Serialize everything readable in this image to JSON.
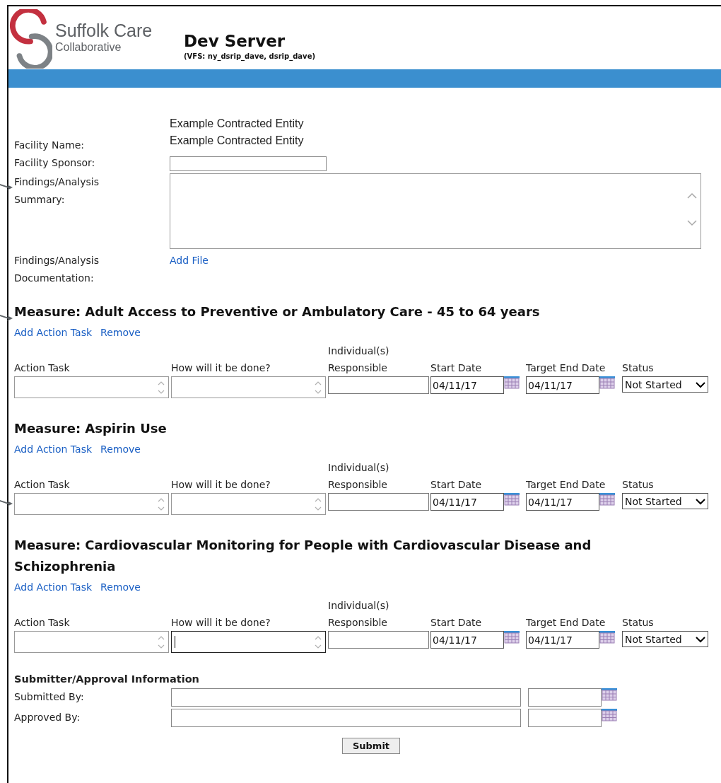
{
  "header": {
    "logo_name": "Suffolk Care",
    "logo_sub": "Collaborative",
    "title": "Dev Server",
    "subtitle": "(VFS: ny_dsrip_dave, dsrip_dave)"
  },
  "entity_heading": "Example Contracted Entity",
  "fields": [
    {
      "label": "Facility Name:",
      "kind": "text",
      "value": "Example Contracted Entity"
    },
    {
      "label": "Facility Sponsor:",
      "kind": "input"
    },
    {
      "label": "Findings/Analysis Summary:",
      "kind": "textarea"
    },
    {
      "label": "Findings/Analysis Documentation:",
      "kind": "link",
      "value": "Add File"
    }
  ],
  "measures": [
    {
      "title": "Measure: Adult Access to Preventive or Ambulatory Care - 45 to 64 years",
      "links": [
        "Add Action Task",
        "Remove"
      ],
      "columns": [
        "Action Task",
        "How will it be done?",
        "Individual(s) Responsible",
        "Start Date",
        "Target End Date",
        "Status"
      ],
      "rows": [
        {
          "how_focused": false,
          "start_date": "04/11/17",
          "end_date": "04/11/17",
          "status": "Not Started"
        }
      ]
    },
    {
      "title": "Measure: Aspirin Use",
      "links": [
        "Add Action Task",
        "Remove"
      ],
      "columns": [
        "Action Task",
        "How will it be done?",
        "Individual(s) Responsible",
        "Start Date",
        "Target End Date",
        "Status"
      ],
      "rows": [
        {
          "how_focused": false,
          "start_date": "04/11/17",
          "end_date": "04/11/17",
          "status": "Not Started"
        }
      ]
    },
    {
      "title": "Measure: Cardiovascular Monitoring for People with Cardiovascular Disease and Schizophrenia",
      "links": [
        "Add Action Task",
        "Remove"
      ],
      "columns": [
        "Action Task",
        "How will it be done?",
        "Individual(s) Responsible",
        "Start Date",
        "Target End Date",
        "Status"
      ],
      "rows": [
        {
          "how_focused": true,
          "start_date": "04/11/17",
          "end_date": "04/11/17",
          "status": "Not Started"
        }
      ]
    }
  ],
  "submitter": {
    "title": "Submitter/Approval Information",
    "rows": [
      {
        "label": "Submitted By:"
      },
      {
        "label": "Approved By:"
      }
    ],
    "submit": "Submit"
  }
}
